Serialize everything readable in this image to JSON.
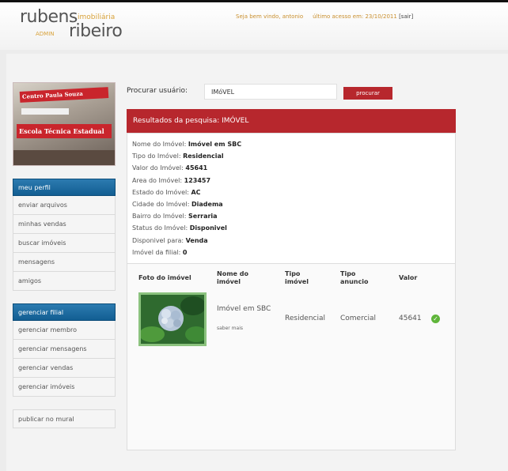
{
  "header": {
    "brand_line1": "rubens",
    "brand_tag": "imobiliária",
    "brand_admin": "ADMIN",
    "brand_line2": "ribeiro",
    "welcome": "Seja bem vindo, antonio",
    "last_access": "último acesso em: 23/10/2011",
    "exit": "[sair]"
  },
  "banner": {
    "sign_top": "Centro Paula Souza",
    "sign_main": "Escola Técnica Estadual"
  },
  "sidebar": {
    "group1_title": "meu perfil",
    "group1_items": [
      "enviar arquivos",
      "minhas vendas",
      "buscar imóveis",
      "mensagens",
      "amigos"
    ],
    "group2_title": "gerenciar filial",
    "group2_items": [
      "gerenciar membro",
      "gerenciar mensagens",
      "gerenciar vendas",
      "gerenciar imóveis"
    ],
    "publish": "publicar no mural"
  },
  "search": {
    "label": "Procurar usuário:",
    "value": "IMóVEL",
    "button": "procurar"
  },
  "results_title": "Resultados da pesquisa: IMÓVEL",
  "details": [
    {
      "label": "Nome do Imóvel:",
      "value": "Imóvel em SBC"
    },
    {
      "label": "Tipo do Imóvel:",
      "value": "Residencial"
    },
    {
      "label": "Valor do Imóvel:",
      "value": "45641"
    },
    {
      "label": "Area do Imóvel:",
      "value": "123457"
    },
    {
      "label": "Estado do Imóvel:",
      "value": "AC"
    },
    {
      "label": "Cidade do Imóvel:",
      "value": "Diadema"
    },
    {
      "label": "Bairro do Imóvel:",
      "value": "Serraria"
    },
    {
      "label": "Status do Imóvel:",
      "value": "Disponivel"
    },
    {
      "label": "Disponivel para:",
      "value": "Venda"
    },
    {
      "label": "Imóvel da filial:",
      "value": "0"
    }
  ],
  "table": {
    "headers": [
      "Foto do imóvel",
      "Nome do imóvel",
      "Tipo imóvel",
      "Tipo anuncio",
      "Valor"
    ],
    "row": {
      "name": "Imóvel em SBC",
      "more": "saber mais",
      "type": "Residencial",
      "ad_type": "Comercial",
      "value": "45641",
      "status_icon": "check-circle-icon"
    }
  },
  "colors": {
    "accent_red": "#b7272d",
    "menu_blue": "#1a6aa0",
    "brand_gold": "#d8a23a",
    "status_green": "#5fb53a"
  }
}
